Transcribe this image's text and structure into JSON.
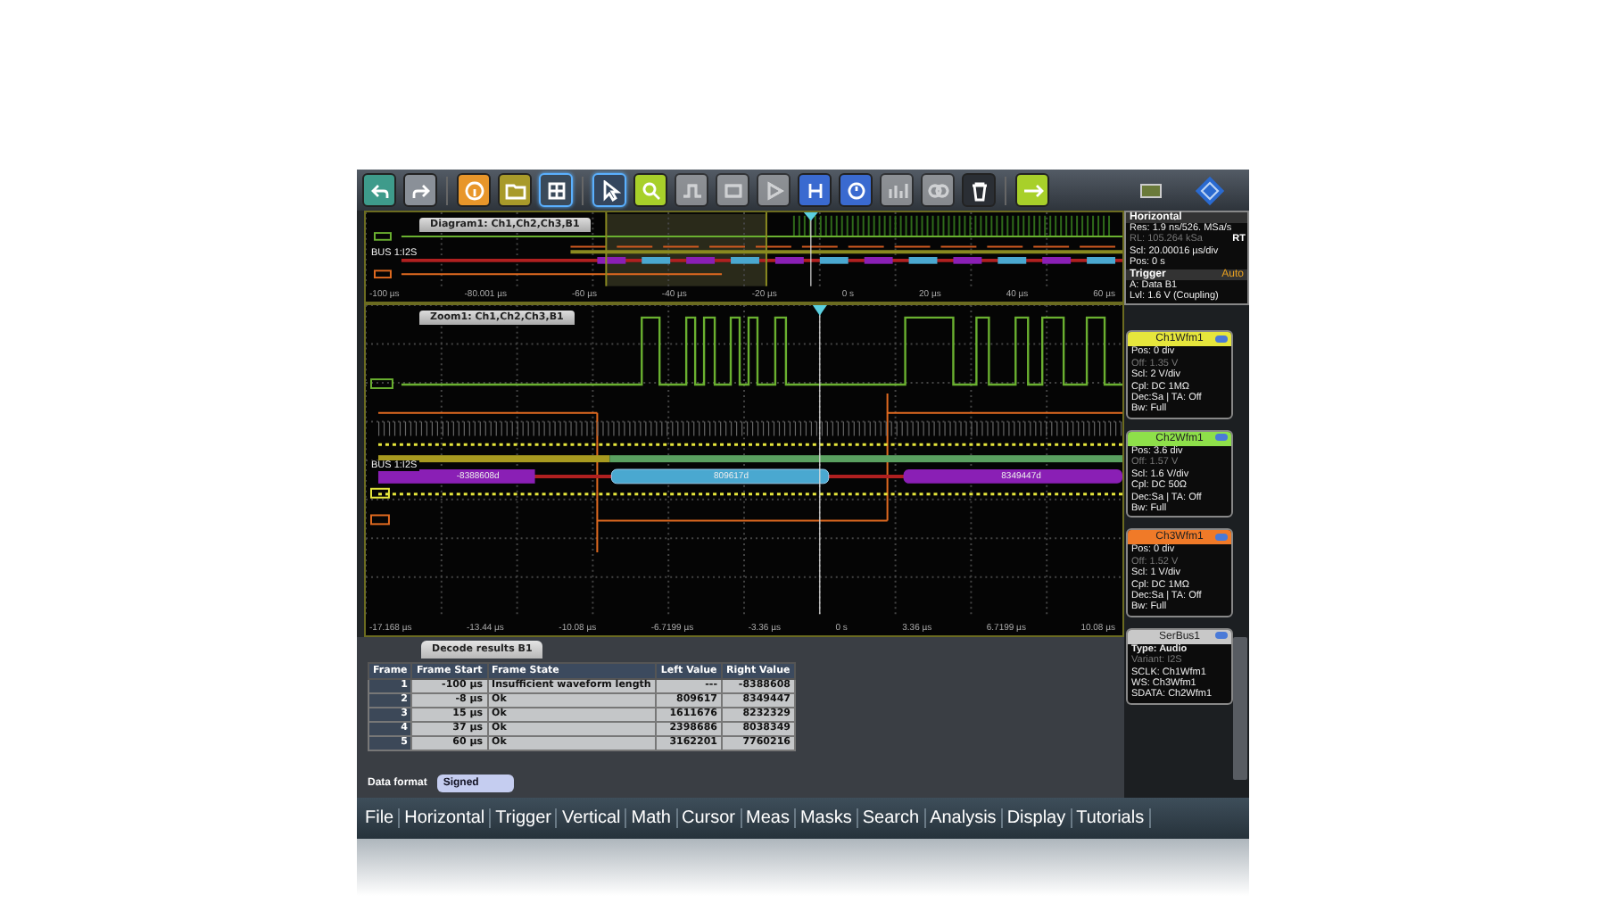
{
  "toolbar": {
    "buttons": [
      {
        "selected": false,
        "disabled": false
      },
      {
        "selected": false,
        "disabled": false
      },
      {
        "selected": false,
        "disabled": false
      },
      {
        "selected": false,
        "disabled": false
      },
      {
        "selected": true,
        "disabled": false
      },
      {
        "selected": true,
        "disabled": false
      },
      {
        "selected": false,
        "disabled": false
      },
      {
        "selected": false,
        "disabled": true
      },
      {
        "selected": false,
        "disabled": true
      },
      {
        "selected": false,
        "disabled": true
      },
      {
        "selected": false,
        "disabled": false
      },
      {
        "selected": false,
        "disabled": false
      },
      {
        "selected": false,
        "disabled": true
      },
      {
        "selected": false,
        "disabled": true
      },
      {
        "selected": false,
        "disabled": false
      },
      {
        "selected": false,
        "disabled": false
      }
    ]
  },
  "diagram": {
    "title": "Diagram1: Ch1,Ch2,Ch3,B1",
    "bus_label": "BUS 1:I2S",
    "time_labels": [
      "-100 µs",
      "-80.001 µs",
      "-60 µs",
      "-40 µs",
      "-20 µs",
      "0 s",
      "20 µs",
      "40 µs",
      "60 µs"
    ]
  },
  "zoom": {
    "title": "Zoom1: Ch1,Ch2,Ch3,B1",
    "bus_label": "BUS 1:I2S",
    "bus_values": [
      "-8388608d",
      "809617d",
      "8349447d"
    ],
    "time_labels": [
      "-17.168 µs",
      "-13.44 µs",
      "-10.08 µs",
      "-6.7199 µs",
      "-3.36 µs",
      "0 s",
      "3.36 µs",
      "6.7199 µs",
      "10.08 µs"
    ]
  },
  "horizontal_panel": {
    "title": "Horizontal",
    "mode": "RT",
    "lines": [
      {
        "text": "Res: 1.9 ns/526. MSa/s",
        "dimmed": false
      },
      {
        "text": "RL: 105.264 kSa",
        "dimmed": true
      },
      {
        "text": "Scl: 20.00016 µs/div",
        "dimmed": false
      },
      {
        "text": "Pos: 0 s",
        "dimmed": false
      }
    ]
  },
  "trigger_panel": {
    "title": "Trigger",
    "mode": "Auto",
    "lines": [
      {
        "text": "A:   Data B1",
        "dimmed": false
      },
      {
        "text": "Lvl: 1.6 V (Coupling)",
        "dimmed": false
      }
    ]
  },
  "channels": [
    {
      "title": "Ch1Wfm1",
      "color": "#e6e63c",
      "lines": [
        {
          "text": "Pos: 0 div",
          "dimmed": false
        },
        {
          "text": "Off: 1.35 V",
          "dimmed": true
        },
        {
          "text": "Scl: 2 V/div",
          "dimmed": false
        },
        {
          "text": "Cpl: DC 1MΩ",
          "dimmed": false
        },
        {
          "text": "Dec:Sa | TA: Off",
          "dimmed": false
        },
        {
          "text": "Bw: Full",
          "dimmed": false
        }
      ]
    },
    {
      "title": "Ch2Wfm1",
      "color": "#8ee04a",
      "lines": [
        {
          "text": "Pos: 3.6 div",
          "dimmed": false
        },
        {
          "text": "Off: 1.57 V",
          "dimmed": true
        },
        {
          "text": "Scl: 1.6 V/div",
          "dimmed": false
        },
        {
          "text": "Cpl: DC 50Ω",
          "dimmed": false
        },
        {
          "text": "Dec:Sa | TA: Off",
          "dimmed": false
        },
        {
          "text": "Bw: Full",
          "dimmed": false
        }
      ]
    },
    {
      "title": "Ch3Wfm1",
      "color": "#f07a28",
      "lines": [
        {
          "text": "Pos: 0 div",
          "dimmed": false
        },
        {
          "text": "Off: 1.52 V",
          "dimmed": true
        },
        {
          "text": "Scl: 1 V/div",
          "dimmed": false
        },
        {
          "text": "Cpl: DC 1MΩ",
          "dimmed": false
        },
        {
          "text": "Dec:Sa | TA: Off",
          "dimmed": false
        },
        {
          "text": "Bw: Full",
          "dimmed": false
        }
      ]
    }
  ],
  "serbus": {
    "title": "SerBus1",
    "type": "Type: Audio",
    "lines": [
      {
        "text": "Variant: I2S",
        "dimmed": true
      },
      {
        "text": "SCLK:   Ch1Wfm1",
        "dimmed": false
      },
      {
        "text": "WS:     Ch3Wfm1",
        "dimmed": false
      },
      {
        "text": "SDATA: Ch2Wfm1",
        "dimmed": false
      }
    ]
  },
  "decode": {
    "tab": "Decode results B1",
    "columns": [
      "Frame",
      "Frame Start",
      "Frame State",
      "Left Value",
      "Right Value"
    ],
    "rows": [
      [
        "1",
        "-100 µs",
        "Insufficient waveform length",
        "---",
        "-8388608"
      ],
      [
        "2",
        "-8 µs",
        "Ok",
        "809617",
        "8349447"
      ],
      [
        "3",
        "15 µs",
        "Ok",
        "1611676",
        "8232329"
      ],
      [
        "4",
        "37 µs",
        "Ok",
        "2398686",
        "8038349"
      ],
      [
        "5",
        "60 µs",
        "Ok",
        "3162201",
        "7760216"
      ]
    ],
    "format_label": "Data format",
    "format_value": "Signed"
  },
  "menu": [
    "File",
    "Horizontal",
    "Trigger",
    "Vertical",
    "Math",
    "Cursor",
    "Meas",
    "Masks",
    "Search",
    "Analysis",
    "Display",
    "Tutorials"
  ]
}
